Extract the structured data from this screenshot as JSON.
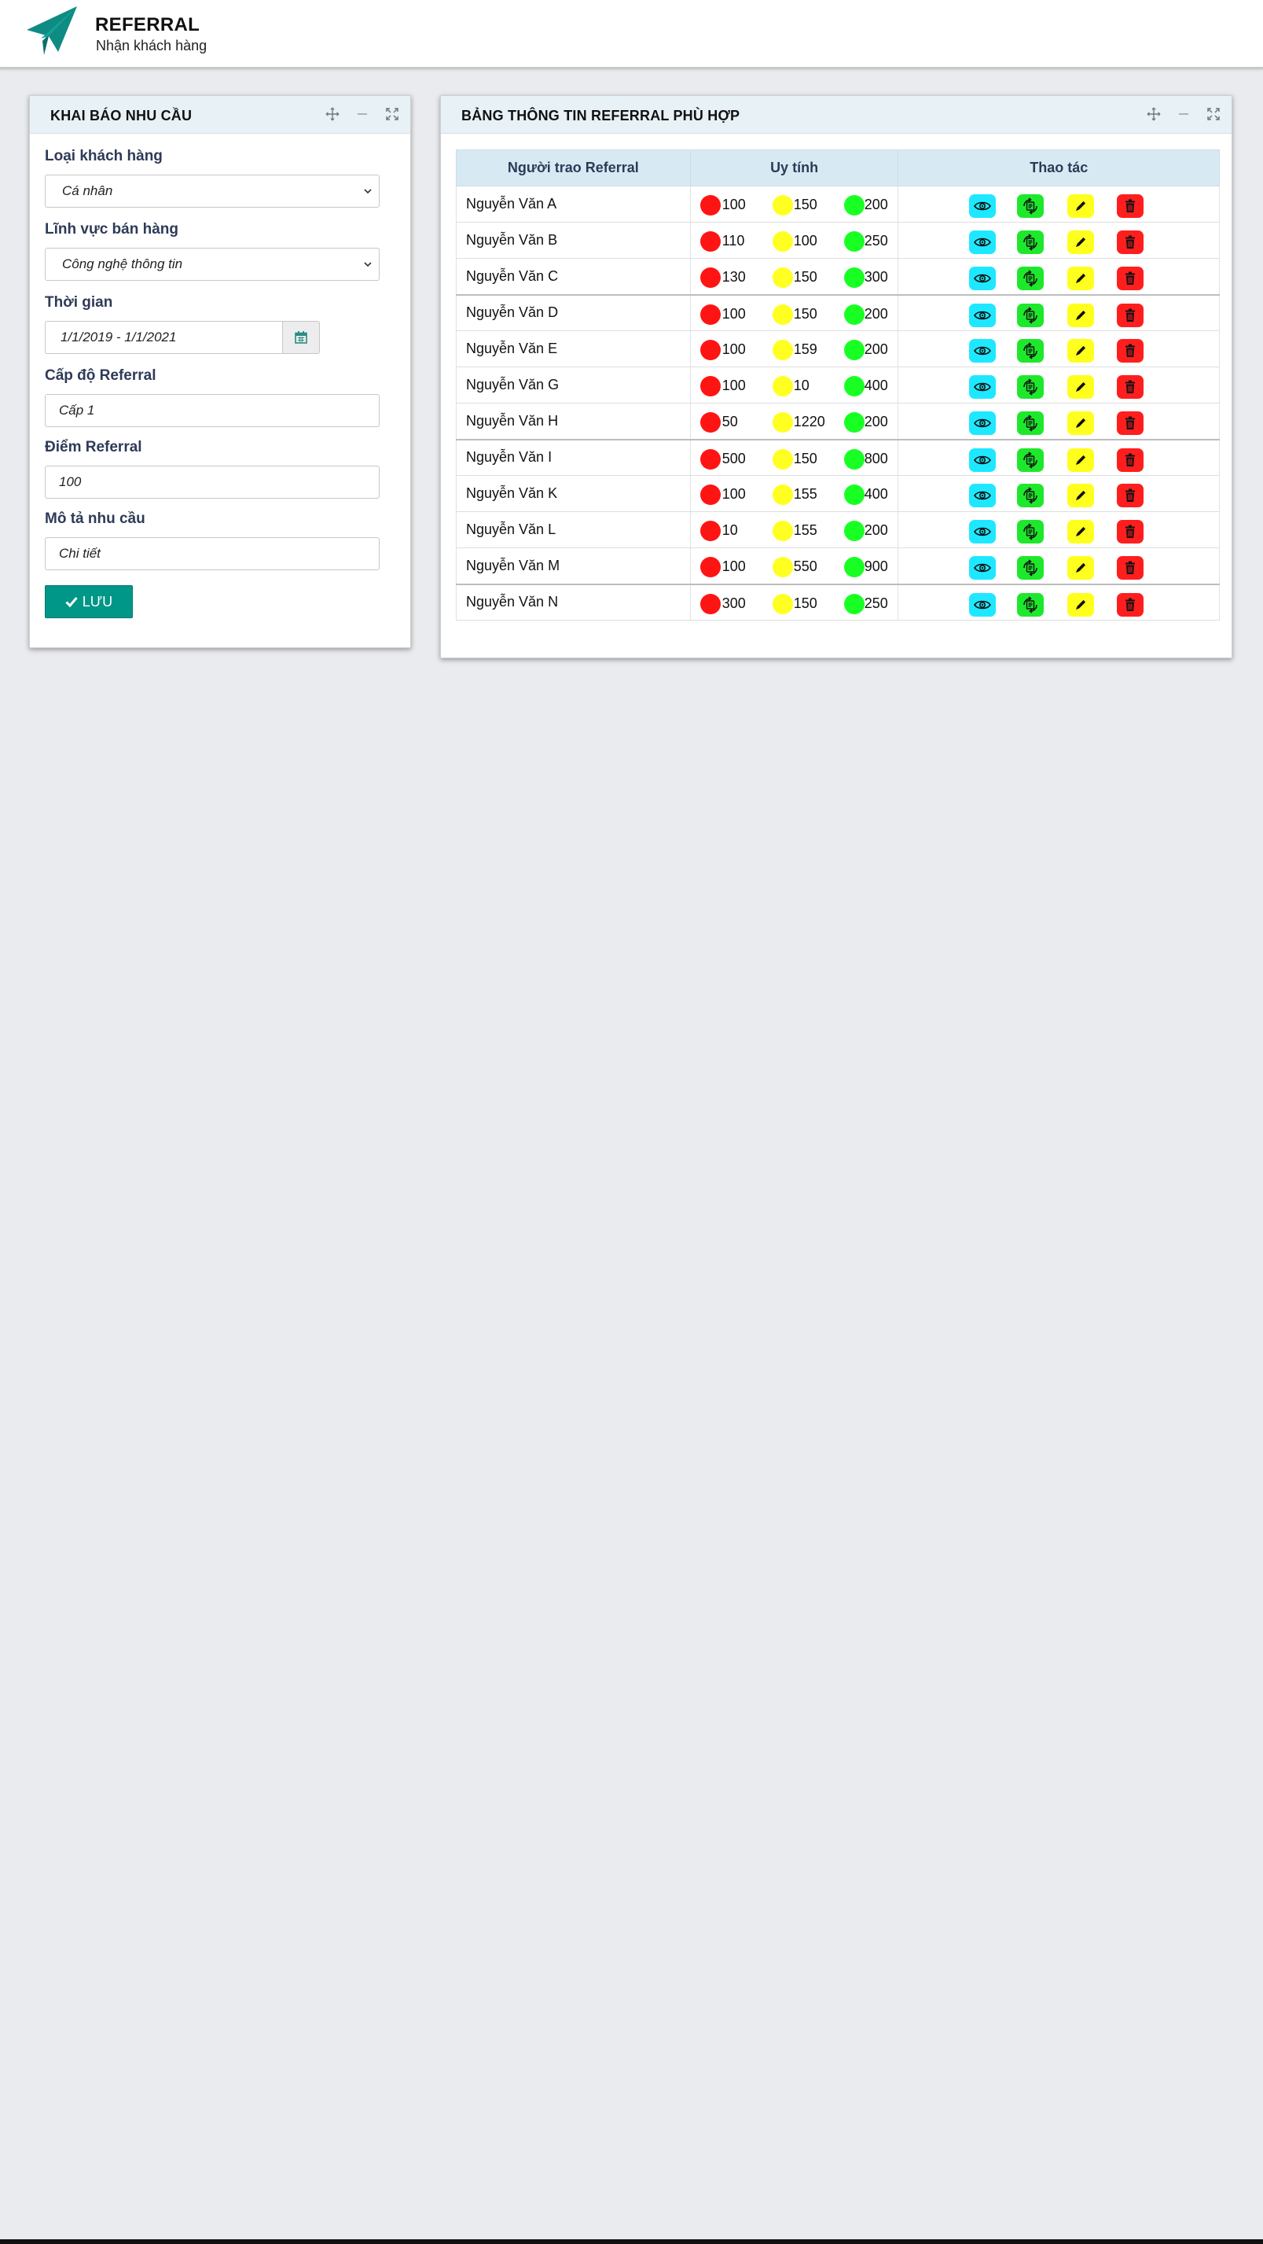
{
  "header": {
    "title": "REFERRAL",
    "subtitle": "Nhận khách hàng",
    "logo_icon": "paper-plane-icon",
    "brand_color": "#0e8c84"
  },
  "left_panel": {
    "title": "KHAI BÁO NHU CẦU",
    "fields": {
      "customer_type": {
        "label": "Loại khách hàng",
        "value": "Cá nhân"
      },
      "sales_field": {
        "label": "Lĩnh vực bán hàng",
        "value": "Công nghệ thông tin"
      },
      "time": {
        "label": "Thời gian",
        "value": "1/1/2019 - 1/1/2021"
      },
      "referral_level": {
        "label": "Cấp độ Referral",
        "value": "Cấp 1"
      },
      "referral_points": {
        "label": "Điểm Referral",
        "value": "100"
      },
      "description": {
        "label": "Mô tả nhu cầu",
        "value": "Chi tiết"
      }
    },
    "save_label": "LƯU",
    "save_color": "#009688"
  },
  "right_panel": {
    "title": "BẢNG THÔNG TIN REFERRAL PHÙ HỢP",
    "columns": [
      "Người trao Referral",
      "Uy tính",
      "Thao tác"
    ],
    "rows": [
      {
        "name": "Nguyễn Văn A",
        "red": "100",
        "yellow": "150",
        "green": "200"
      },
      {
        "name": "Nguyễn Văn B",
        "red": "110",
        "yellow": "100",
        "green": "250"
      },
      {
        "name": "Nguyễn Văn C",
        "red": "130",
        "yellow": "150",
        "green": "300"
      },
      {
        "name": "Nguyễn Văn D",
        "red": "100",
        "yellow": "150",
        "green": "200"
      },
      {
        "name": "Nguyễn Văn E",
        "red": "100",
        "yellow": "159",
        "green": "200"
      },
      {
        "name": "Nguyễn Văn G",
        "red": "100",
        "yellow": "10",
        "green": "400"
      },
      {
        "name": "Nguyễn Văn H",
        "red": "50",
        "yellow": "1220",
        "green": "200"
      },
      {
        "name": "Nguyễn Văn I",
        "red": "500",
        "yellow": "150",
        "green": "800"
      },
      {
        "name": "Nguyễn Văn K",
        "red": "100",
        "yellow": "155",
        "green": "400"
      },
      {
        "name": "Nguyễn Văn L",
        "red": "10",
        "yellow": "155",
        "green": "200"
      },
      {
        "name": "Nguyễn Văn M",
        "red": "100",
        "yellow": "550",
        "green": "900"
      },
      {
        "name": "Nguyễn Văn N",
        "red": "300",
        "yellow": "150",
        "green": "250"
      }
    ],
    "action_icons": [
      "eye-icon",
      "swap-icon",
      "pencil-icon",
      "trash-icon"
    ],
    "status_colors": {
      "red": "#ff1414",
      "yellow": "#ffff22",
      "green": "#18ff24"
    }
  }
}
